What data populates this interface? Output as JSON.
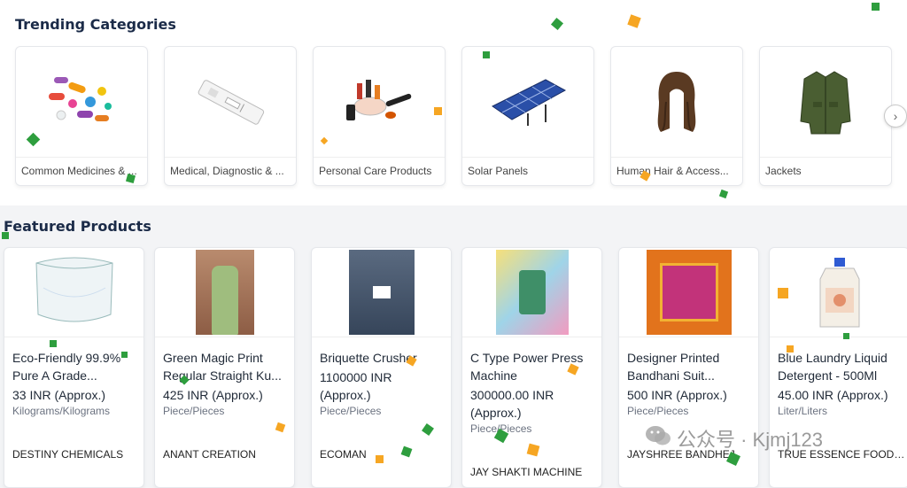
{
  "trending": {
    "title": "Trending Categories",
    "categories": [
      {
        "label": "Common Medicines & ...",
        "icon": "medicine-pills-icon"
      },
      {
        "label": "Medical, Diagnostic & ...",
        "icon": "test-strip-icon"
      },
      {
        "label": "Personal Care Products",
        "icon": "cosmetics-icon"
      },
      {
        "label": "Solar Panels",
        "icon": "solar-panel-icon"
      },
      {
        "label": "Human Hair & Access...",
        "icon": "hair-wig-icon"
      },
      {
        "label": "Jackets",
        "icon": "jacket-icon"
      }
    ],
    "next_icon": "chevron-right-icon"
  },
  "featured": {
    "title": "Featured Products",
    "products": [
      {
        "name": "Eco-Friendly 99.9% Pure A Grade...",
        "price": "33 INR (Approx.)",
        "unit": "Kilograms/Kilograms",
        "seller": "DESTINY CHEMICALS"
      },
      {
        "name": "Green Magic Print Regular Straight Ku...",
        "price": "425 INR (Approx.)",
        "unit": "Piece/Pieces",
        "seller": "ANANT CREATION"
      },
      {
        "name": "Briquette Crusher",
        "price": "1100000 INR (Approx.)",
        "unit": "Piece/Pieces",
        "seller": "ECOMAN"
      },
      {
        "name": "C Type Power Press Machine",
        "price": "300000.00 INR (Approx.)",
        "unit": "Piece/Pieces",
        "seller": "JAY SHAKTI MACHINE"
      },
      {
        "name": "Designer Printed Bandhani Suit...",
        "price": "500 INR (Approx.)",
        "unit": "Piece/Pieces",
        "seller": "JAYSHREE BANDHEJ"
      },
      {
        "name": "Blue Laundry Liquid Detergent - 500Ml",
        "price": "45.00 INR (Approx.)",
        "unit": "Liter/Liters",
        "seller": "TRUE ESSENCE FOODS..."
      }
    ]
  },
  "watermark": {
    "text": "公众号 · Kjmj123",
    "icon": "wechat-icon"
  },
  "colors": {
    "heading": "#1b2b48",
    "confetti_green": "#2e9e3e",
    "confetti_orange": "#f6a623"
  }
}
